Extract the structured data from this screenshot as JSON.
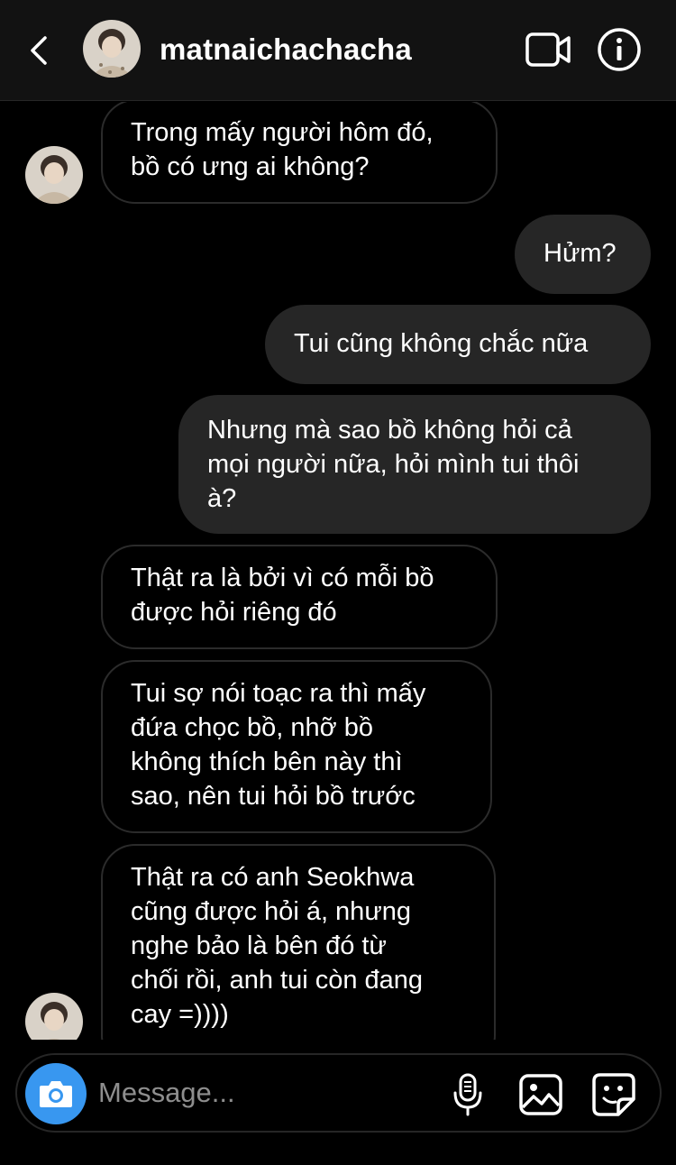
{
  "header": {
    "username": "matnaichachacha",
    "icons": {
      "back": "chevron-left-icon",
      "video": "video-camera-icon",
      "info": "info-icon"
    }
  },
  "messages": [
    {
      "side": "in",
      "lines": [
        "Trong mấy người hôm đó,",
        "bồ có ưng ai không?"
      ]
    },
    {
      "side": "out",
      "lines": [
        "Hửm?"
      ]
    },
    {
      "side": "out",
      "lines": [
        "Tui cũng không chắc nữa"
      ]
    },
    {
      "side": "out",
      "lines": [
        "Nhưng mà sao bồ không hỏi cả",
        "mọi người nữa, hỏi mình tui thôi",
        "à?"
      ]
    },
    {
      "side": "in",
      "lines": [
        "Thật ra là bởi vì có mỗi bồ",
        "được hỏi riêng đó"
      ]
    },
    {
      "side": "in",
      "lines": [
        "Tui sợ nói toạc ra thì mấy",
        "đứa chọc bồ, nhỡ bồ",
        "không thích bên này thì",
        "sao, nên tui hỏi bồ trước"
      ]
    },
    {
      "side": "in",
      "lines": [
        "Thật ra có anh Seokhwa",
        "cũng được hỏi á, nhưng",
        "nghe bảo là bên đó từ",
        "chối rồi, anh tui còn đang",
        "cay =))))"
      ]
    }
  ],
  "composer": {
    "placeholder": "Message...",
    "icons": {
      "camera": "camera-icon",
      "mic": "microphone-icon",
      "gallery": "image-gallery-icon",
      "sticker": "sticker-icon"
    }
  },
  "colors": {
    "background": "#000000",
    "header_bg": "#121212",
    "outgoing_bubble": "#262626",
    "incoming_border": "#2b2b2b",
    "accent_blue": "#3897f0",
    "placeholder_text": "#8e8e8e"
  }
}
